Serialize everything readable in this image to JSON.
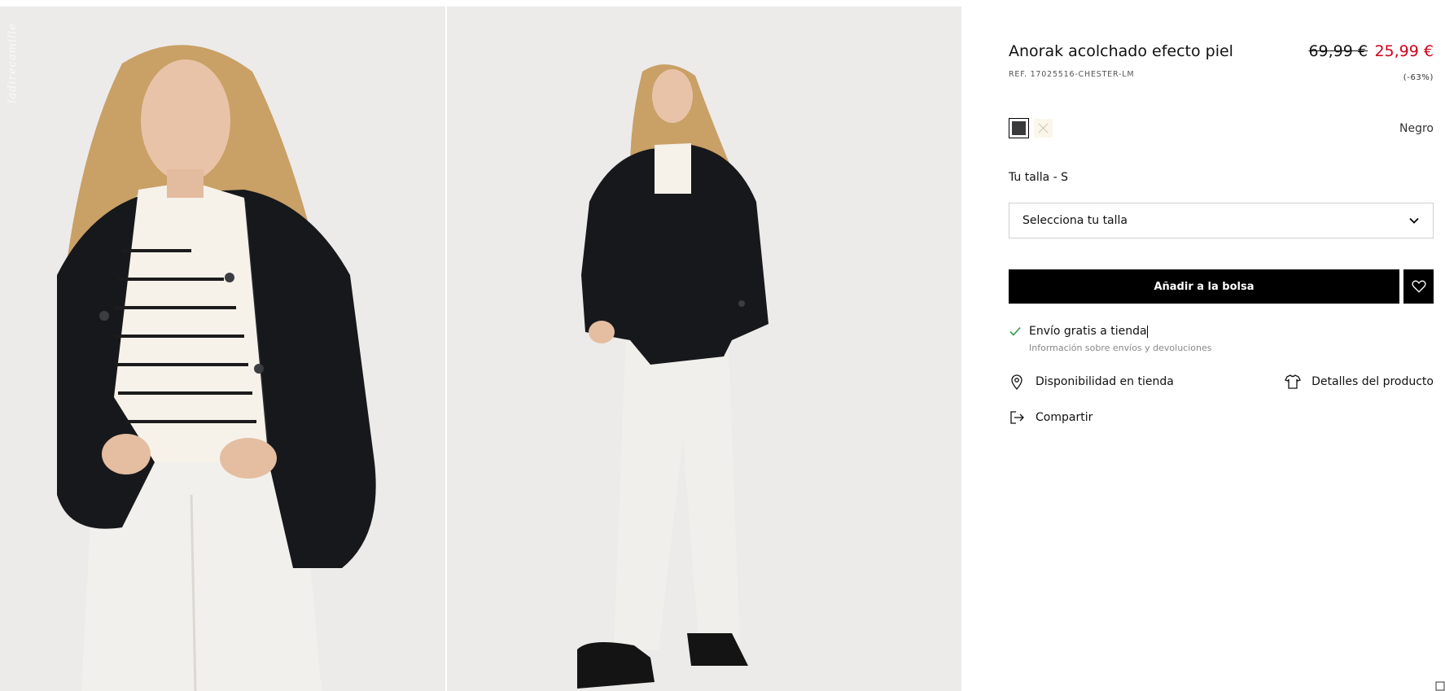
{
  "gallery": {
    "watermark": "ladirecamille"
  },
  "product": {
    "title": "Anorak acolchado efecto piel",
    "ref": "REF. 17025516-CHESTER-LM",
    "old_price": "69,99 €",
    "new_price": "25,99 €",
    "discount": "(-63%)",
    "price_color": "#d0021b"
  },
  "colors": {
    "selected_name": "Negro",
    "swatches": [
      {
        "name": "negro",
        "hex": "#3a3a3c",
        "selected": true
      },
      {
        "name": "crudo",
        "hex": "#faf6ea",
        "selected": false,
        "unavailable": true
      }
    ]
  },
  "size": {
    "label": "Tu talla - S",
    "select_placeholder": "Selecciona tu talla",
    "icon": "chevron-down-icon"
  },
  "actions": {
    "add_to_bag": "Añadir a la bolsa",
    "wishlist_icon": "heart-icon"
  },
  "shipping": {
    "title": "Envío gratis a tienda",
    "info_link": "Información sobre envíos y devoluciones",
    "icon": "check-icon"
  },
  "links": {
    "store": "Disponibilidad en tienda",
    "details": "Detalles del producto",
    "share": "Compartir"
  }
}
